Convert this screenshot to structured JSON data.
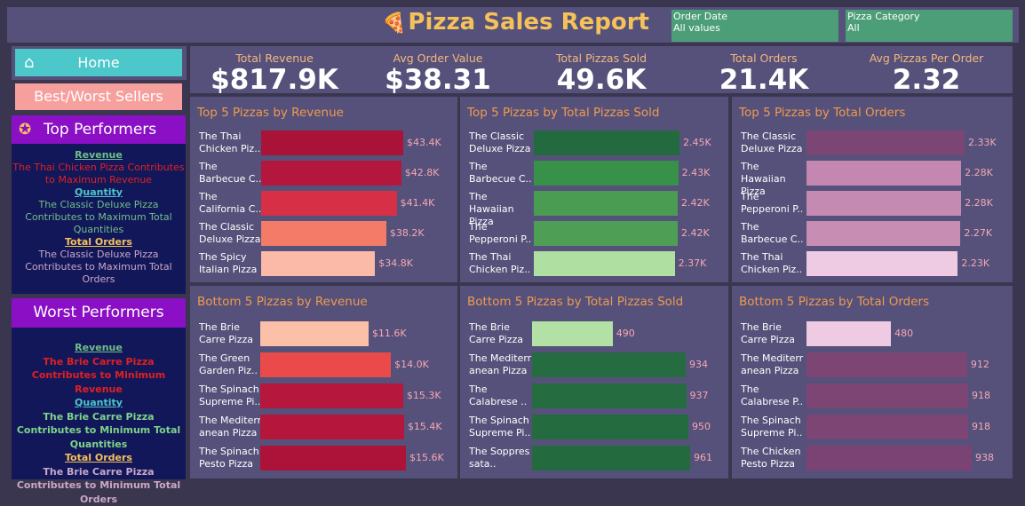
{
  "header": {
    "title": "Pizza Sales Report",
    "logo_icon": "pizza-icon",
    "filters": [
      {
        "label": "Order Date",
        "value": "All values"
      },
      {
        "label": "Pizza Category",
        "value": "All"
      }
    ]
  },
  "nav": {
    "home": "Home",
    "best_worst": "Best/Worst Sellers",
    "home_icon": "house-icon"
  },
  "top_performers": {
    "title": "Top Performers",
    "icon": "medal-icon",
    "revenue_label": "Revenue",
    "revenue_text": "The Thai Chicken Pizza Contributes to Maximum Revenue",
    "quantity_label": "Quantity",
    "quantity_text": "The Classic Deluxe Pizza Contributes to Maximum Total Quantities",
    "orders_label": "Total Orders",
    "orders_text": "The Classic Deluxe Pizza Contributes to Maximum Total Orders"
  },
  "worst_performers": {
    "title": "Worst Performers",
    "revenue_label": "Revenue",
    "revenue_text": "The Brie Carre Pizza Contributes to Minimum Revenue",
    "quantity_label": "Quantity",
    "quantity_text": "The Brie Carre Pizza Contributes to Minimum Total Quantities",
    "orders_label": "Total Orders",
    "orders_text": "The Brie Carre Pizza Contributes to Minimum Total Orders"
  },
  "kpis": [
    {
      "label": "Total Revenue",
      "value": "$817.9K"
    },
    {
      "label": "Avg Order Value",
      "value": "$38.31"
    },
    {
      "label": "Total Pizzas Sold",
      "value": "49.6K"
    },
    {
      "label": "Total Orders",
      "value": "21.4K"
    },
    {
      "label": "Avg Pizzas Per Order",
      "value": "2.32"
    }
  ],
  "chart_data": [
    {
      "type": "bar",
      "title": "Top 5 Pizzas by Revenue",
      "categories": [
        "The Thai Chicken Piz..",
        "The Barbecue C..",
        "The California C..",
        "The Classic Deluxe Pizza",
        "The Spicy Italian Pizza"
      ],
      "values": [
        43.4,
        42.8,
        41.4,
        38.2,
        34.8
      ],
      "value_labels": [
        "$43.4K",
        "$42.8K",
        "$41.4K",
        "$38.2K",
        "$34.8K"
      ],
      "colors": [
        "#a91338",
        "#b4173d",
        "#d72f45",
        "#f47b68",
        "#fbb9a8"
      ]
    },
    {
      "type": "bar",
      "title": "Top 5 Pizzas by Total Pizzas Sold",
      "categories": [
        "The Classic Deluxe Pizza",
        "The Barbecue C..",
        "The Hawaiian Pizza",
        "The Pepperoni P..",
        "The Thai Chicken Piz.."
      ],
      "values": [
        2.45,
        2.43,
        2.42,
        2.42,
        2.37
      ],
      "value_labels": [
        "2.45K",
        "2.43K",
        "2.42K",
        "2.42K",
        "2.37K"
      ],
      "colors": [
        "#236b3f",
        "#379148",
        "#4a9c52",
        "#4e9e55",
        "#afe0a2"
      ]
    },
    {
      "type": "bar",
      "title": "Top 5 Pizzas by Total Orders",
      "categories": [
        "The Classic Deluxe Pizza",
        "The Hawaiian Pizza",
        "The Pepperoni P..",
        "The Barbecue C..",
        "The Thai Chicken Piz.."
      ],
      "values": [
        2.33,
        2.28,
        2.28,
        2.27,
        2.23
      ],
      "value_labels": [
        "2.33K",
        "2.28K",
        "2.28K",
        "2.27K",
        "2.23K"
      ],
      "colors": [
        "#7b4574",
        "#c487b1",
        "#c48ab2",
        "#c78db3",
        "#eecbe3"
      ]
    },
    {
      "type": "bar",
      "title": "Bottom 5 Pizzas by Revenue",
      "categories": [
        "The Brie Carre Pizza",
        "The Green Garden Piz..",
        "The Spinach Supreme Pi..",
        "The Mediterr anean Pizza",
        "The Spinach Pesto Pizza"
      ],
      "values": [
        11.6,
        14.0,
        15.3,
        15.4,
        15.6
      ],
      "value_labels": [
        "$11.6K",
        "$14.0K",
        "$15.3K",
        "$15.4K",
        "$15.6K"
      ],
      "colors": [
        "#fcc0a8",
        "#ea4b4a",
        "#b6173d",
        "#b5173c",
        "#ad1238"
      ]
    },
    {
      "type": "bar",
      "title": "Bottom 5 Pizzas by Total Pizzas Sold",
      "categories": [
        "The Brie Carre Pizza",
        "The Mediterr anean Pizza",
        "The Calabrese ..",
        "The Spinach Supreme Pi..",
        "The Soppres sata.."
      ],
      "values": [
        490,
        934,
        937,
        950,
        961
      ],
      "value_labels": [
        "490",
        "934",
        "937",
        "950",
        "961"
      ],
      "colors": [
        "#b3e0a5",
        "#256c40",
        "#256c40",
        "#246b3f",
        "#236a3e"
      ]
    },
    {
      "type": "bar",
      "title": "Bottom 5 Pizzas by Total Orders",
      "categories": [
        "The Brie Carre Pizza",
        "The Mediterr anean Pizza",
        "The Calabrese P..",
        "The Spinach Supreme Pi..",
        "The Chicken Pesto Pizza"
      ],
      "values": [
        480,
        912,
        918,
        918,
        938
      ],
      "value_labels": [
        "480",
        "912",
        "918",
        "918",
        "938"
      ],
      "colors": [
        "#eecbe3",
        "#7c4574",
        "#7c4574",
        "#7c4574",
        "#7a4373"
      ]
    }
  ]
}
